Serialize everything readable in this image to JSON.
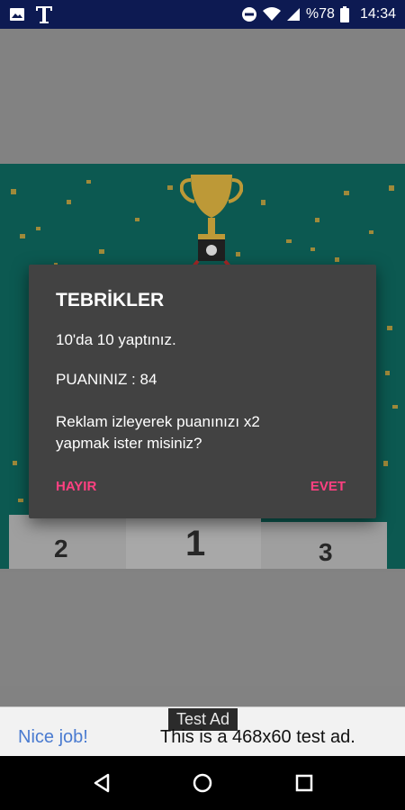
{
  "status_bar": {
    "battery_text": "%78",
    "time": "14:34"
  },
  "dialog": {
    "title": "TEBRİKLER",
    "line1": "10'da 10 yaptınız.",
    "score_line": "PUANINIZ : 84",
    "question": "Reklam izleyerek puanınızı x2 yapmak ister misiniz?",
    "negative_button": "HAYIR",
    "positive_button": "EVET",
    "accent_color": "#ff4081"
  },
  "podium": {
    "left": "2",
    "center": "1",
    "right": "3"
  },
  "ad_banner": {
    "label": "Test Ad",
    "link_text": "Nice job!",
    "body_text": "This is a 468x60 test ad."
  },
  "nav": {
    "back": "back-icon",
    "home": "home-icon",
    "recents": "recents-icon"
  }
}
